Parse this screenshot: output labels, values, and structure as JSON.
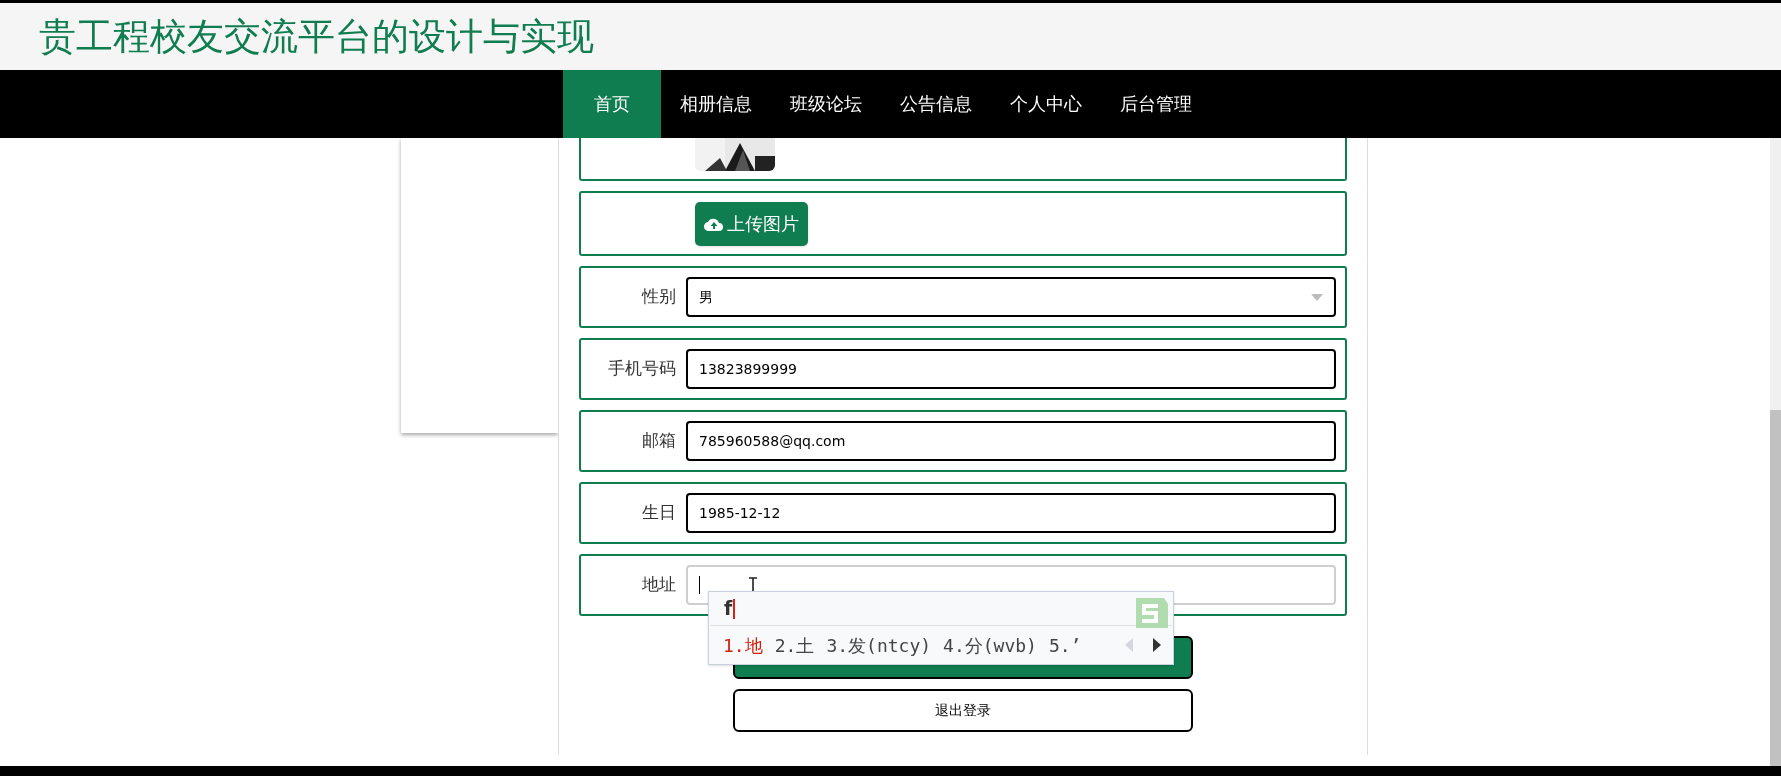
{
  "site_title": "贵工程校友交流平台的设计与实现",
  "nav": [
    {
      "label": "首页",
      "selected": true
    },
    {
      "label": "相册信息",
      "selected": false
    },
    {
      "label": "班级论坛",
      "selected": false
    },
    {
      "label": "公告信息",
      "selected": false
    },
    {
      "label": "个人中心",
      "selected": false
    },
    {
      "label": "后台管理",
      "selected": false
    }
  ],
  "form": {
    "upload_button": "上传图片",
    "fields": [
      {
        "kind": "select",
        "label": "性别",
        "value": "男",
        "focused": false
      },
      {
        "kind": "text",
        "label": "手机号码",
        "value": "13823899999",
        "focused": false
      },
      {
        "kind": "text",
        "label": "邮箱",
        "value": "785960588@qq.com",
        "focused": false
      },
      {
        "kind": "text",
        "label": "生日",
        "value": "1985-12-12",
        "focused": false
      },
      {
        "kind": "text",
        "label": "地址",
        "focused": true
      }
    ],
    "logout_button": "退出登录"
  },
  "ime": {
    "input": "f",
    "candidates": [
      {
        "label": "1.地",
        "selected": true
      },
      {
        "label": "2.土",
        "selected": false
      },
      {
        "label": "3.发(ntcy)",
        "selected": false
      },
      {
        "label": "4.分(wvb)",
        "selected": false
      },
      {
        "label": "5.’",
        "selected": false
      }
    ]
  }
}
